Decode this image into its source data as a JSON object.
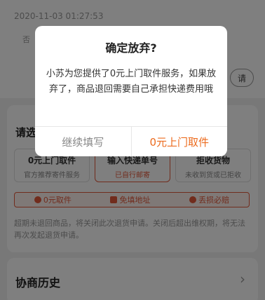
{
  "background": {
    "timestamp": "2020-11-03 01:27:53",
    "peek_text": "否",
    "apply_pill": "请",
    "section_title": "请选",
    "options": [
      {
        "title": "0元上门取件",
        "sub": "官方推荐寄件服务"
      },
      {
        "title": "输入快递单号",
        "sub": "已自行邮寄"
      },
      {
        "title": "拒收货物",
        "sub": "未收到货或已拒收"
      }
    ],
    "bar_items": [
      "0元取件",
      "免填地址",
      "丢损必赔"
    ],
    "notice": "超期未退回商品，将关闭此次退货申请。关闭后超出维权期，将无法再次发起退货申请。",
    "history_title": "协商历史",
    "colors": {
      "accent": "#e2593b",
      "confirm": "#ec6b1e"
    }
  },
  "dialog": {
    "title": "确定放弃?",
    "body": "小苏为您提供了0元上门取件服务，如果放弃了，商品退回需要自己承担快递费用哦",
    "cancel_label": "继续填写",
    "confirm_label": "0元上门取件"
  }
}
